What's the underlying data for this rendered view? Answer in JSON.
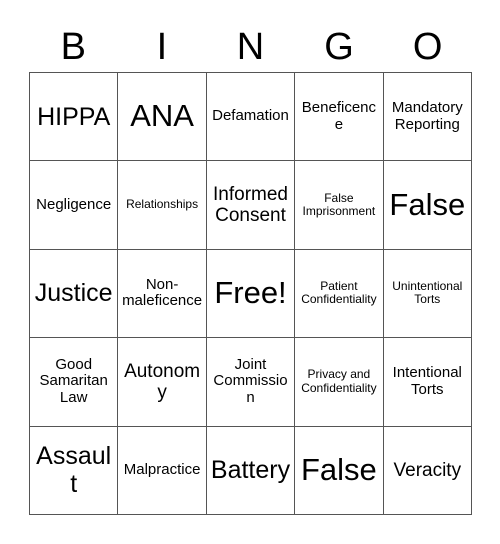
{
  "header": {
    "letters": [
      "B",
      "I",
      "N",
      "G",
      "O"
    ]
  },
  "grid": {
    "rows": [
      [
        {
          "label": "HIPPA",
          "size": "lg"
        },
        {
          "label": "ANA",
          "size": "xl"
        },
        {
          "label": "Defamation",
          "size": "sm"
        },
        {
          "label": "Beneficence",
          "size": "sm"
        },
        {
          "label": "Mandatory Reporting",
          "size": "sm"
        }
      ],
      [
        {
          "label": "Negligence",
          "size": "sm"
        },
        {
          "label": "Relationships",
          "size": "xs"
        },
        {
          "label": "Informed Consent",
          "size": "md"
        },
        {
          "label": "False Imprisonment",
          "size": "xs"
        },
        {
          "label": "False",
          "size": "xl"
        }
      ],
      [
        {
          "label": "Justice",
          "size": "lg"
        },
        {
          "label": "Non-maleficence",
          "size": "sm"
        },
        {
          "label": "Free!",
          "size": "xl"
        },
        {
          "label": "Patient Confidentiality",
          "size": "xs"
        },
        {
          "label": "Unintentional Torts",
          "size": "xs"
        }
      ],
      [
        {
          "label": "Good Samaritan Law",
          "size": "sm"
        },
        {
          "label": "Autonomy",
          "size": "md"
        },
        {
          "label": "Joint Commission",
          "size": "sm"
        },
        {
          "label": "Privacy and Confidentiality",
          "size": "xs"
        },
        {
          "label": "Intentional Torts",
          "size": "sm"
        }
      ],
      [
        {
          "label": "Assault",
          "size": "lg"
        },
        {
          "label": "Malpractice",
          "size": "sm"
        },
        {
          "label": "Battery",
          "size": "lg"
        },
        {
          "label": "False",
          "size": "xl"
        },
        {
          "label": "Veracity",
          "size": "md"
        }
      ]
    ]
  },
  "colors": {
    "border": "#555555",
    "text": "#000000",
    "background": "#ffffff"
  }
}
